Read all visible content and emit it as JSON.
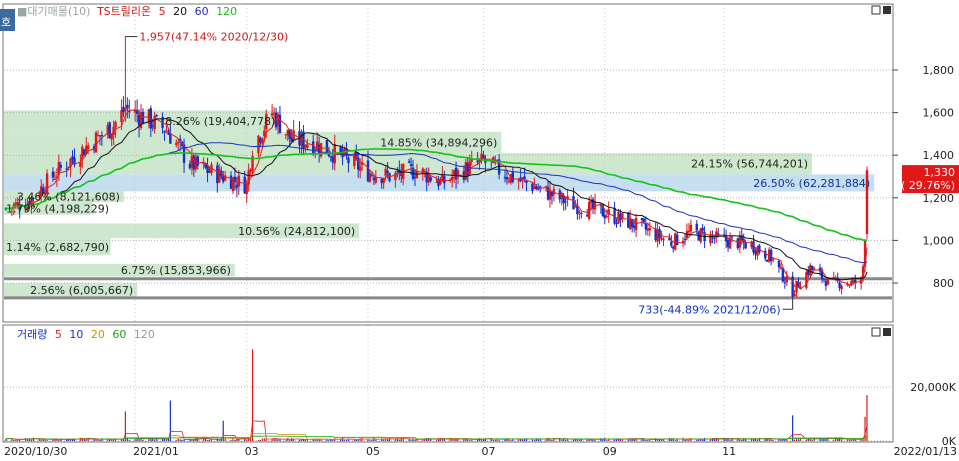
{
  "header": {
    "corner_label": "호",
    "price_legend": [
      {
        "label": "■대기매물(10)",
        "color": "#9aa7a0"
      },
      {
        "label": "TS트릴리온",
        "color": "#d01818"
      },
      {
        "label": "5",
        "color": "#e02020"
      },
      {
        "label": "20",
        "color": "#111111"
      },
      {
        "label": "60",
        "color": "#2030c0"
      },
      {
        "label": "120",
        "color": "#18c018"
      }
    ],
    "volume_legend": [
      {
        "label": "거래량",
        "color": "#1030c0"
      },
      {
        "label": "5",
        "color": "#e02020"
      },
      {
        "label": "10",
        "color": "#2030c0"
      },
      {
        "label": "20",
        "color": "#d09000"
      },
      {
        "label": "60",
        "color": "#18a018"
      },
      {
        "label": "120",
        "color": "#999999"
      }
    ]
  },
  "colors": {
    "up": "#e01818",
    "down": "#1030d0",
    "ma5": "#e02020",
    "ma20": "#111111",
    "ma60": "#2030c0",
    "ma120": "#18c018",
    "supply_band": "#cde8cf",
    "supply_band_current": "#c6dff0",
    "price_tag": "#e01818"
  },
  "chart_data": [
    {
      "type": "candlestick",
      "name": "price",
      "y_ticks": [
        "1,800",
        "1,600",
        "1,400",
        "1,200",
        "1,000",
        "800"
      ],
      "y_values": [
        1800,
        1600,
        1400,
        1200,
        1000,
        800
      ],
      "ylim": [
        720,
        2000
      ],
      "x_labels": [
        "2020/10/30",
        "2021/01",
        "03",
        "05",
        "07",
        "09",
        "11",
        "2022/01/13"
      ],
      "x_positions": [
        "2020-10-30",
        "2021-01-04",
        "2021-03-02",
        "2021-05-03",
        "2021-07-01",
        "2021-09-01",
        "2021-11-01",
        "2022-01-13"
      ],
      "current_price": {
        "value": 1330,
        "label": "1,330",
        "change": "( 29.76%)"
      },
      "annotations": {
        "high": {
          "label": "1,957(47.14% 2020/12/30)",
          "value": 1957,
          "date": "2020-12-30"
        },
        "low": {
          "label": "733(-44.89% 2021/12/06)",
          "value": 733,
          "date": "2021-12-06"
        }
      },
      "keypoints": [
        [
          "2020-10-30",
          1150
        ],
        [
          "2020-11-10",
          1180
        ],
        [
          "2020-11-25",
          1320
        ],
        [
          "2020-12-10",
          1440
        ],
        [
          "2020-12-24",
          1540
        ],
        [
          "2020-12-30",
          1620
        ],
        [
          "2021-01-08",
          1580
        ],
        [
          "2021-01-20",
          1520
        ],
        [
          "2021-02-01",
          1360
        ],
        [
          "2021-02-15",
          1310
        ],
        [
          "2021-03-02",
          1260
        ],
        [
          "2021-03-05",
          1440
        ],
        [
          "2021-03-15",
          1600
        ],
        [
          "2021-03-25",
          1470
        ],
        [
          "2021-04-05",
          1460
        ],
        [
          "2021-04-20",
          1390
        ],
        [
          "2021-05-03",
          1320
        ],
        [
          "2021-05-15",
          1300
        ],
        [
          "2021-05-28",
          1330
        ],
        [
          "2021-06-10",
          1270
        ],
        [
          "2021-06-25",
          1350
        ],
        [
          "2021-07-01",
          1370
        ],
        [
          "2021-07-15",
          1300
        ],
        [
          "2021-07-30",
          1240
        ],
        [
          "2021-08-15",
          1170
        ],
        [
          "2021-09-01",
          1130
        ],
        [
          "2021-09-20",
          1060
        ],
        [
          "2021-10-05",
          990
        ],
        [
          "2021-10-15",
          1040
        ],
        [
          "2021-11-01",
          1000
        ],
        [
          "2021-11-15",
          980
        ],
        [
          "2021-11-25",
          920
        ],
        [
          "2021-12-06",
          760
        ],
        [
          "2021-12-15",
          870
        ],
        [
          "2021-12-25",
          800
        ],
        [
          "2022-01-06",
          800
        ],
        [
          "2022-01-10",
          810
        ],
        [
          "2022-01-11",
          880
        ],
        [
          "2022-01-12",
          1030
        ],
        [
          "2022-01-13",
          1330
        ]
      ],
      "supply_zones": [
        {
          "label": "8.26% (19,404,778)",
          "low": 1510,
          "high": 1610
        },
        {
          "label": "14.85% (34,894,296)",
          "low": 1410,
          "high": 1510
        },
        {
          "label": "24.15% (56,744,201)",
          "low": 1310,
          "high": 1410
        },
        {
          "label": "26.50% (62,281,884)",
          "low": 1230,
          "high": 1310,
          "current": true
        },
        {
          "label": "3.46% (8,121,608)",
          "low": 1180,
          "high": 1230
        },
        {
          "label": "1.79% (4,198,229)",
          "low": 1120,
          "high": 1180
        },
        {
          "label": "10.56% (24,812,100)",
          "low": 1010,
          "high": 1080
        },
        {
          "label": "1.14% (2,682,790)",
          "low": 930,
          "high": 1010
        },
        {
          "label": "6.75% (15,853,966)",
          "low": 830,
          "high": 890
        },
        {
          "label": "2.56% (6,005,667)",
          "low": 735,
          "high": 800
        }
      ],
      "gray_levels": [
        820,
        730
      ]
    },
    {
      "type": "bar",
      "name": "volume",
      "y_ticks": [
        "20,000K",
        "0K"
      ],
      "y_values": [
        20000,
        0
      ],
      "ylim": [
        0,
        35000
      ],
      "spikes": [
        [
          "2020-12-30",
          11000
        ],
        [
          "2021-01-22",
          15000
        ],
        [
          "2021-02-18",
          7500
        ],
        [
          "2021-03-05",
          34000
        ],
        [
          "2021-12-06",
          9500
        ],
        [
          "2022-01-12",
          9000
        ],
        [
          "2022-01-13",
          17000
        ]
      ]
    }
  ]
}
